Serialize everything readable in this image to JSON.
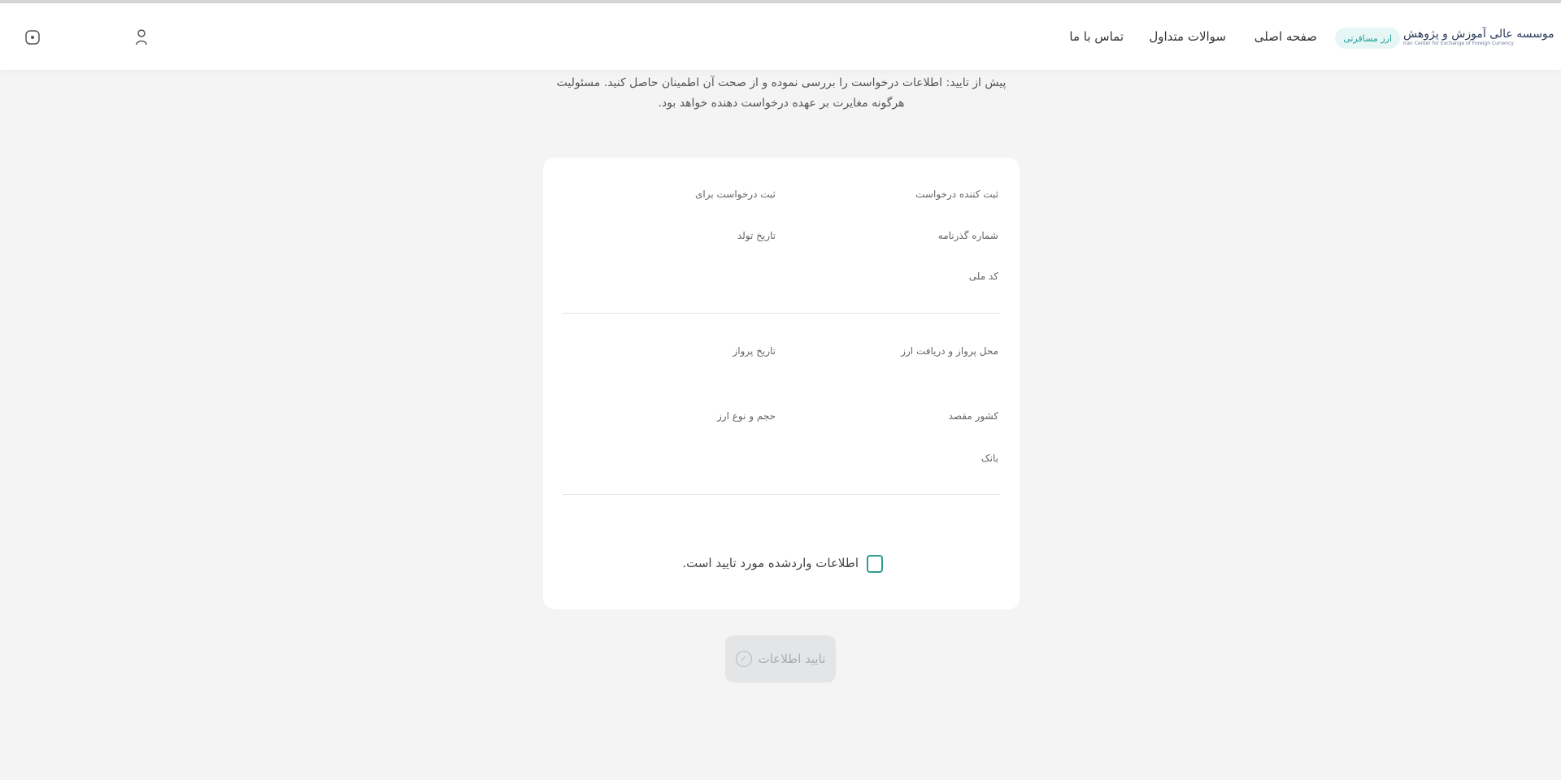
{
  "header": {
    "logo_text": "موسسه عالی آموزش و پژوهش",
    "logo_subtext": "Iran Center for Exchange of Foreign Currency",
    "badge": "ارز مسافرتی",
    "nav": [
      {
        "label": "صفحه اصلی"
      },
      {
        "label": "سوالات متداول"
      },
      {
        "label": "تماس با ما"
      }
    ],
    "icons": [
      "user-icon",
      "menu-circle-icon",
      "logo-icon"
    ]
  },
  "notice": {
    "line1": "پیش از تایید: اطلاعات درخواست را بررسی نموده و از صحت آن اطمینان حاصل کنید. مسئولیت",
    "line2": "هرگونه مغایرت بر عهده درخواست دهنده خواهد بود."
  },
  "form": {
    "requester_label": "ثبت کننده درخواست",
    "request_for_label": "ثبت درخواست برای",
    "passport_label": "شماره گذرنامه",
    "birthdate_label": "تاریخ تولد",
    "national_code_label": "کد ملی",
    "flight_place_label": "محل پرواز و دریافت ارز",
    "flight_date_label": "تاریخ پرواز",
    "destination_label": "کشور مقصد",
    "currency_label": "حجم و نوع ارز",
    "bank_label": "بانک",
    "confirm_text": "اطلاعات واردشده مورد تایید است."
  },
  "submit": {
    "label": "تایید اطلاعات",
    "state": "disabled"
  },
  "colors": {
    "accent": "#2f9c8e",
    "badge_bg": "#e6f6f5",
    "background": "#f4f4f5"
  }
}
